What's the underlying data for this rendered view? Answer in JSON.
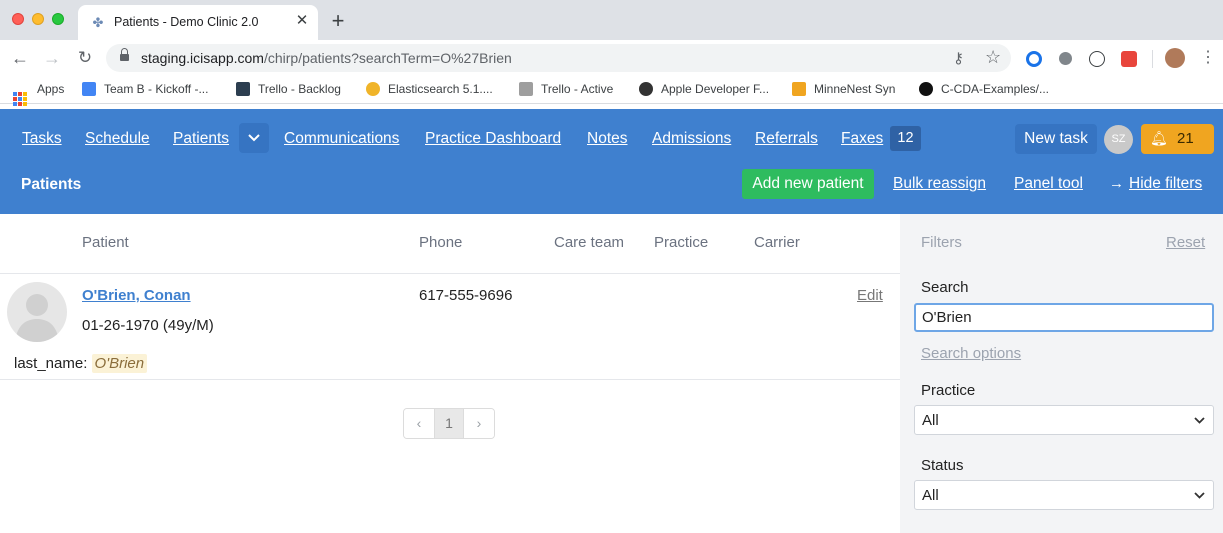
{
  "browser": {
    "tab_title": "Patients - Demo Clinic 2.0",
    "url_host": "staging.icisapp.com",
    "url_path": "/chirp/patients?searchTerm=O%27Brien",
    "bookmarks": [
      {
        "label": "Apps",
        "icon": "apps-grid-icon"
      },
      {
        "label": "Team B - Kickoff -...",
        "icon": "docs-icon",
        "color": "#4285f4"
      },
      {
        "label": "Trello - Backlog",
        "icon": "trello-icon",
        "color": "#2c3e50"
      },
      {
        "label": "Elasticsearch 5.1....",
        "icon": "elastic-icon",
        "color": "#f0b429"
      },
      {
        "label": "Trello - Active",
        "icon": "trello-icon",
        "color": "#9e9e9e"
      },
      {
        "label": "Apple Developer F...",
        "icon": "globe-icon",
        "color": "#333333"
      },
      {
        "label": "MinneNest Syn",
        "icon": "r-icon",
        "color": "#f0a520"
      },
      {
        "label": "C-CDA-Examples/...",
        "icon": "github-icon",
        "color": "#111111"
      }
    ]
  },
  "nav": {
    "tasks": "Tasks",
    "schedule": "Schedule",
    "patients": "Patients",
    "communications": "Communications",
    "practice_dashboard": "Practice Dashboard",
    "notes": "Notes",
    "admissions": "Admissions",
    "referrals": "Referrals",
    "faxes": "Faxes",
    "faxes_count": "12",
    "new_task": "New task",
    "user_initials": "SZ",
    "notifications_count": "21"
  },
  "subheader": {
    "title": "Patients",
    "add_new_patient": "Add new patient",
    "bulk_reassign": "Bulk reassign",
    "panel_tool": "Panel tool",
    "hide_filters": "Hide filters"
  },
  "table": {
    "columns": [
      "Patient",
      "Phone",
      "Care team",
      "Practice",
      "Carrier"
    ],
    "rows": [
      {
        "name": "O'Brien, Conan",
        "dob": "01-26-1970 (49y/M)",
        "phone": "617-555-9696",
        "edit": "Edit",
        "match_field": "last_name:",
        "match_value": "O'Brien"
      }
    ]
  },
  "pagination": {
    "current_page": "1",
    "prev": "‹",
    "next": "›"
  },
  "filters": {
    "title": "Filters",
    "reset": "Reset",
    "search_label": "Search",
    "search_value": "O'Brien",
    "search_options": "Search options",
    "practice_label": "Practice",
    "practice_value": "All",
    "status_label": "Status",
    "status_value": "All"
  },
  "colors": {
    "header_blue": "#3f80cf",
    "add_green": "#2ebc5f",
    "notif_orange": "#f0a520"
  }
}
